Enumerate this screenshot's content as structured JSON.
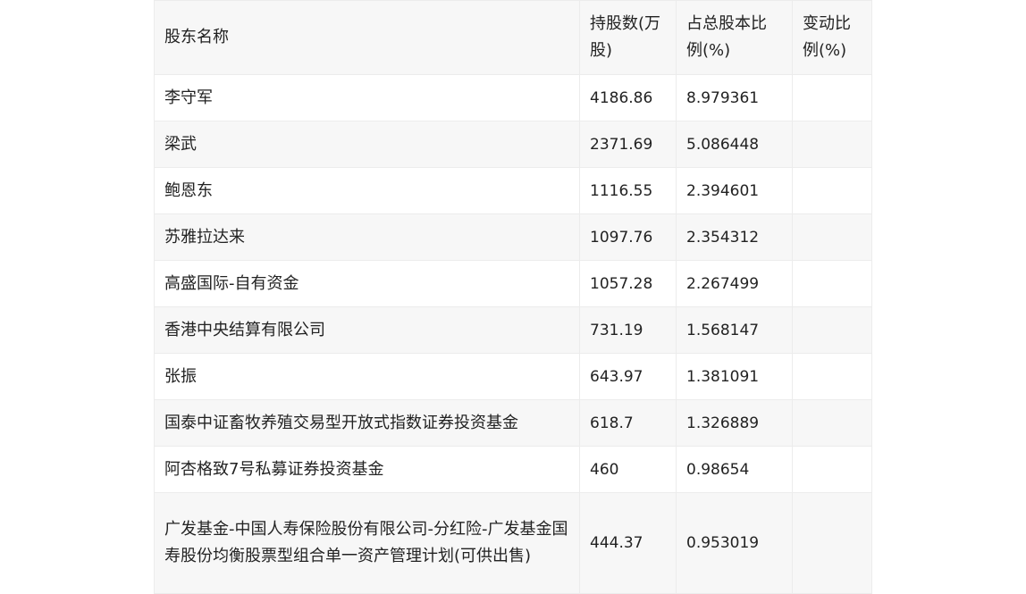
{
  "table": {
    "headers": [
      "股东名称",
      "持股数(万股)",
      "占总股本比例(%)",
      "变动比例(%)"
    ],
    "rows": [
      {
        "name": "李守军",
        "shares": "4186.86",
        "ratio": "8.979361",
        "change": ""
      },
      {
        "name": "梁武",
        "shares": "2371.69",
        "ratio": "5.086448",
        "change": ""
      },
      {
        "name": "鲍恩东",
        "shares": "1116.55",
        "ratio": "2.394601",
        "change": ""
      },
      {
        "name": "苏雅拉达来",
        "shares": "1097.76",
        "ratio": "2.354312",
        "change": ""
      },
      {
        "name": "高盛国际-自有资金",
        "shares": "1057.28",
        "ratio": "2.267499",
        "change": ""
      },
      {
        "name": "香港中央结算有限公司",
        "shares": "731.19",
        "ratio": "1.568147",
        "change": ""
      },
      {
        "name": "张振",
        "shares": "643.97",
        "ratio": "1.381091",
        "change": ""
      },
      {
        "name": "国泰中证畜牧养殖交易型开放式指数证券投资基金",
        "shares": "618.7",
        "ratio": "1.326889",
        "change": ""
      },
      {
        "name": "阿杏格致7号私募证券投资基金",
        "shares": "460",
        "ratio": "0.98654",
        "change": ""
      },
      {
        "name": "广发基金-中国人寿保险股份有限公司-分红险-广发基金国寿股份均衡股票型组合单一资产管理计划(可供出售)",
        "shares": "444.37",
        "ratio": "0.953019",
        "change": ""
      }
    ]
  }
}
